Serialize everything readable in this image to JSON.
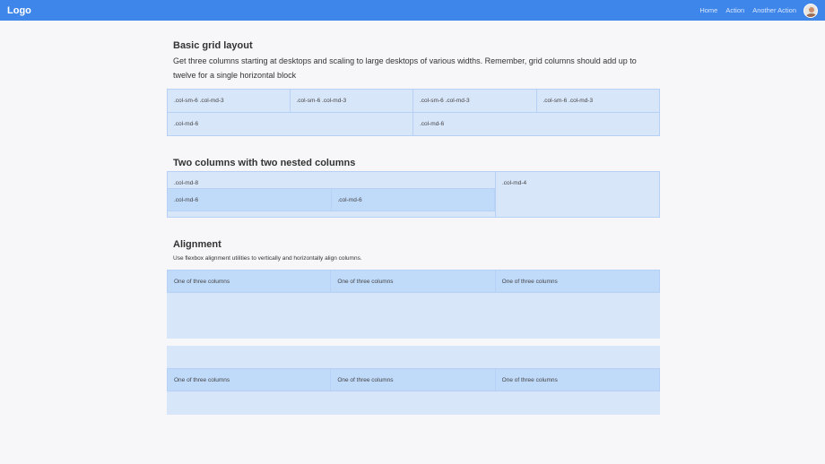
{
  "navbar": {
    "brand": "Logo",
    "links": [
      "Home",
      "Action",
      "Another Action"
    ]
  },
  "section1": {
    "title": "Basic grid layout",
    "lead": "Get three columns starting at desktops and scaling to large desktops of various widths. Remember, grid columns should add up to twelve for a single horizontal block",
    "row1": [
      ".col-sm-6 .col-md-3",
      ".col-sm-6 .col-md-3",
      ".col-sm-6 .col-md-3",
      ".col-sm-6 .col-md-3"
    ],
    "row2": [
      ".col-md-6",
      ".col-md-6"
    ]
  },
  "section2": {
    "title": "Two columns with two nested columns",
    "outer_left": ".col-md-8",
    "outer_right": ".col-md-4",
    "nested": [
      ".col-md-6",
      ".col-md-6"
    ]
  },
  "section3": {
    "title": "Alignment",
    "note": "Use flexbox alignment utilities to vertically and horizontally align columns.",
    "top_row": [
      "One of three columns",
      "One of three columns",
      "One of three columns"
    ],
    "bottom_row": [
      "One of three columns",
      "One of three columns",
      "One of three columns"
    ]
  }
}
